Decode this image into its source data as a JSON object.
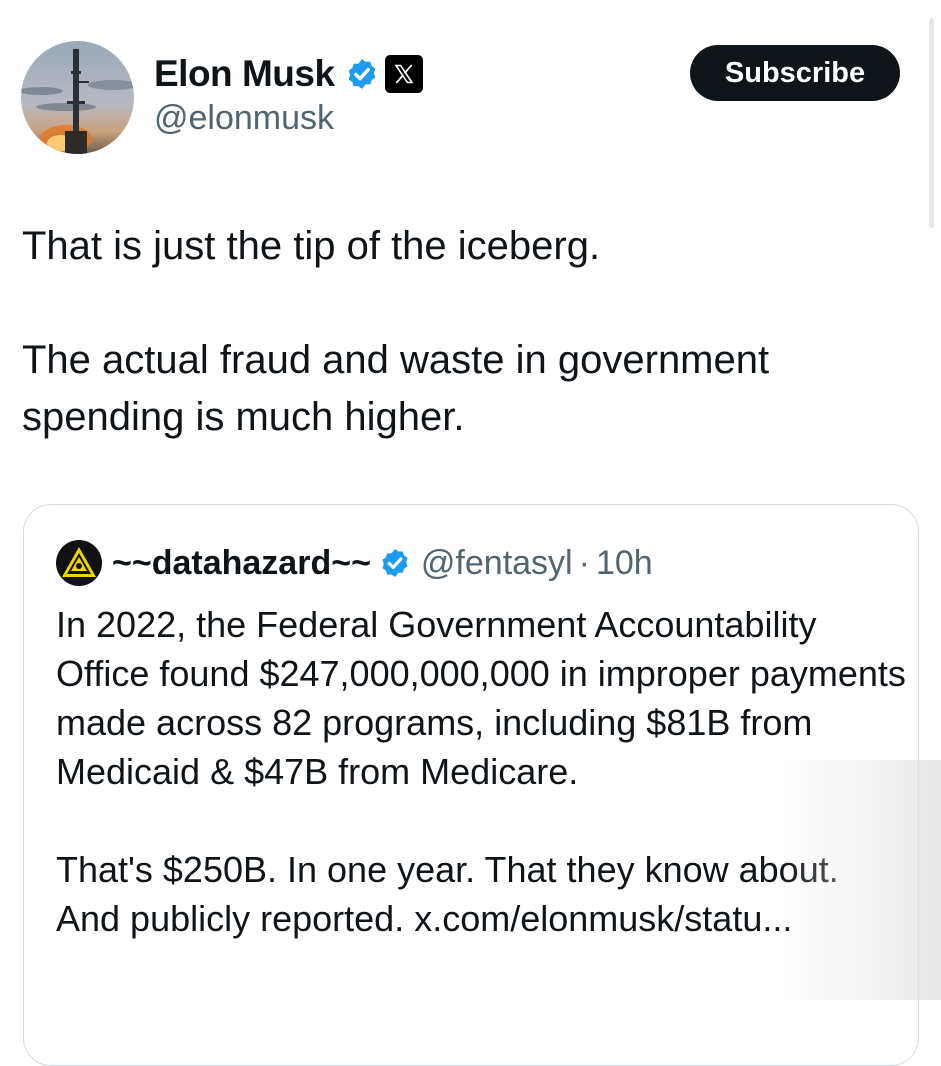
{
  "author": {
    "display_name": "Elon Musk",
    "handle": "@elonmusk",
    "verified_icon": "verified-badge-icon",
    "affiliation_icon": "x-logo-icon"
  },
  "subscribe_label": "Subscribe",
  "tweet": {
    "paragraphs": [
      "That is just the tip of the iceberg.",
      "The actual fraud and waste in government spending is much higher."
    ]
  },
  "quoted_tweet": {
    "display_name": "~~datahazard~~",
    "handle": "@fentasyl",
    "separator": "·",
    "time": "10h",
    "paragraphs": [
      "In 2022, the Federal Government Accountability Office found $247,000,000,000 in improper payments made across 82 programs, including $81B from Medicaid & $47B from Medicare.",
      "That's $250B. In one year. That they know about. And publicly reported. x.com/elonmusk/statu..."
    ]
  },
  "colors": {
    "text": "#0f1419",
    "secondary": "#536471",
    "verified_blue": "#1d9bf0",
    "button_bg": "#0f1419",
    "border": "#cfd9de",
    "hazard_yellow": "#f2d400"
  }
}
